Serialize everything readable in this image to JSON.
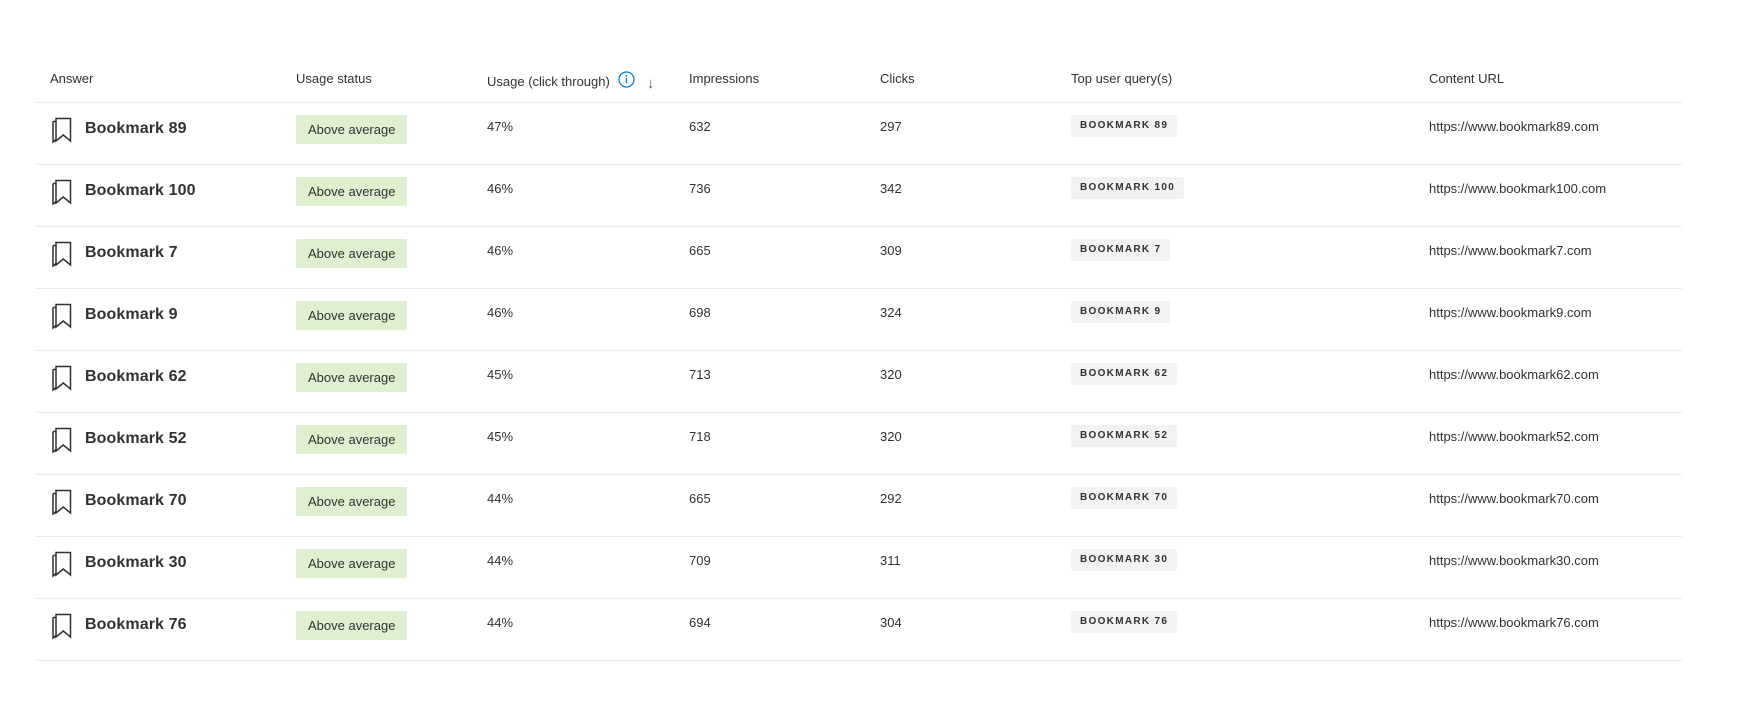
{
  "table": {
    "columns": {
      "answer": "Answer",
      "usage_status": "Usage status",
      "usage": "Usage (click through)",
      "impressions": "Impressions",
      "clicks": "Clicks",
      "top_queries": "Top user query(s)",
      "content_url": "Content URL"
    },
    "icons": {
      "info": "info-icon",
      "sort": "sort-descending-icon",
      "row": "bookmark-icon"
    },
    "sort_glyph": "↓",
    "colors": {
      "status_badge_bg": "#dff0d0",
      "query_chip_bg": "#f3f2f1",
      "info_icon": "#0078d4"
    },
    "rows": [
      {
        "answer": "Bookmark 89",
        "status": "Above average",
        "usage": "47%",
        "impressions": "632",
        "clicks": "297",
        "query": "BOOKMARK 89",
        "url": "https://www.bookmark89.com"
      },
      {
        "answer": "Bookmark 100",
        "status": "Above average",
        "usage": "46%",
        "impressions": "736",
        "clicks": "342",
        "query": "BOOKMARK 100",
        "url": "https://www.bookmark100.com"
      },
      {
        "answer": "Bookmark 7",
        "status": "Above average",
        "usage": "46%",
        "impressions": "665",
        "clicks": "309",
        "query": "BOOKMARK 7",
        "url": "https://www.bookmark7.com"
      },
      {
        "answer": "Bookmark 9",
        "status": "Above average",
        "usage": "46%",
        "impressions": "698",
        "clicks": "324",
        "query": "BOOKMARK 9",
        "url": "https://www.bookmark9.com"
      },
      {
        "answer": "Bookmark 62",
        "status": "Above average",
        "usage": "45%",
        "impressions": "713",
        "clicks": "320",
        "query": "BOOKMARK 62",
        "url": "https://www.bookmark62.com"
      },
      {
        "answer": "Bookmark 52",
        "status": "Above average",
        "usage": "45%",
        "impressions": "718",
        "clicks": "320",
        "query": "BOOKMARK 52",
        "url": "https://www.bookmark52.com"
      },
      {
        "answer": "Bookmark 70",
        "status": "Above average",
        "usage": "44%",
        "impressions": "665",
        "clicks": "292",
        "query": "BOOKMARK 70",
        "url": "https://www.bookmark70.com"
      },
      {
        "answer": "Bookmark 30",
        "status": "Above average",
        "usage": "44%",
        "impressions": "709",
        "clicks": "311",
        "query": "BOOKMARK 30",
        "url": "https://www.bookmark30.com"
      },
      {
        "answer": "Bookmark 76",
        "status": "Above average",
        "usage": "44%",
        "impressions": "694",
        "clicks": "304",
        "query": "BOOKMARK 76",
        "url": "https://www.bookmark76.com"
      }
    ]
  }
}
